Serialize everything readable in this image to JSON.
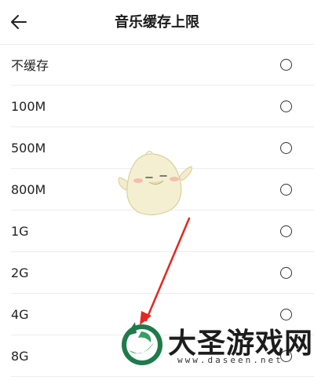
{
  "header": {
    "title": "音乐缓存上限",
    "back_icon": "arrow-left-icon"
  },
  "options": [
    {
      "label": "不缓存",
      "selected": false
    },
    {
      "label": "100M",
      "selected": false
    },
    {
      "label": "500M",
      "selected": false
    },
    {
      "label": "800M",
      "selected": false
    },
    {
      "label": "1G",
      "selected": false
    },
    {
      "label": "2G",
      "selected": false
    },
    {
      "label": "4G",
      "selected": false
    },
    {
      "label": "8G",
      "selected": false
    }
  ],
  "watermark": {
    "title": "大圣游戏网",
    "url": "www.daseen.net"
  },
  "colors": {
    "arrow": "#e8251f",
    "logo_green": "#1f7a4a"
  }
}
